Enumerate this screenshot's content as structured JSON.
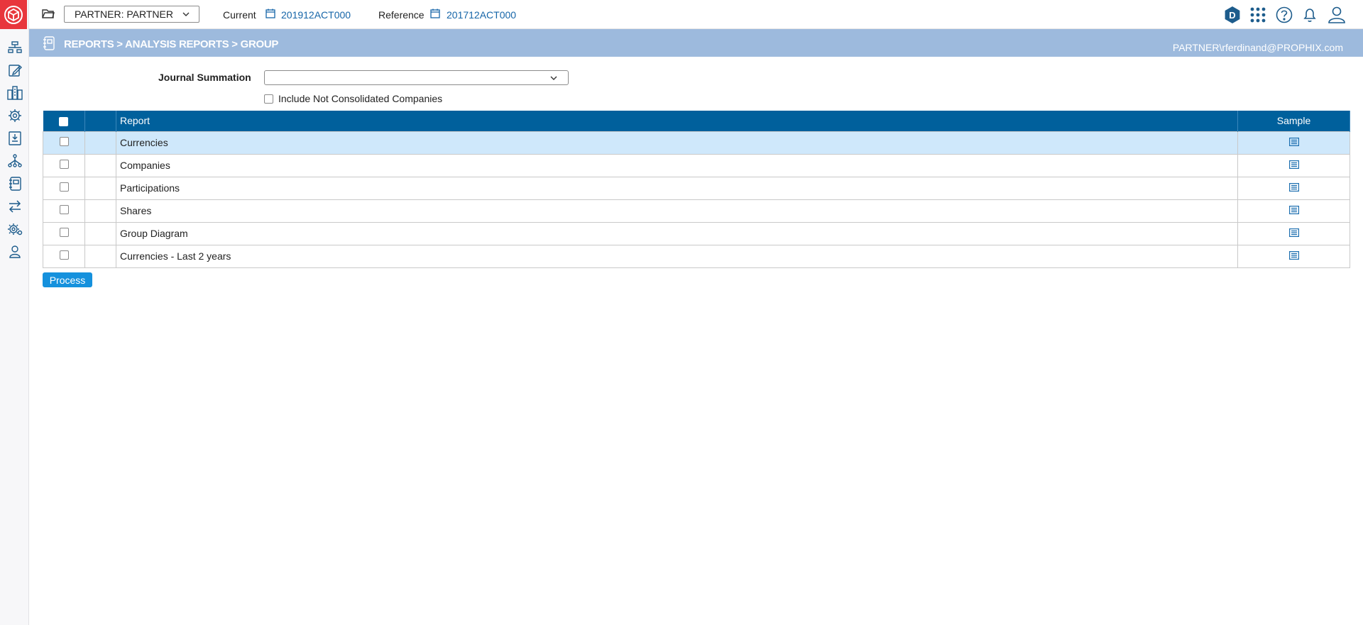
{
  "topbar": {
    "entity_select": "PARTNER: PARTNER",
    "current_label": "Current",
    "current_value": "201912ACT000",
    "reference_label": "Reference",
    "reference_value": "201712ACT000",
    "badge_letter": "D"
  },
  "header": {
    "breadcrumb": "REPORTS > ANALYSIS REPORTS > GROUP",
    "user": "PARTNER\\rferdinand@PROPHIX.com"
  },
  "form": {
    "journal_summation_label": "Journal Summation",
    "journal_summation_value": "",
    "include_not_consolidated_label": "Include Not Consolidated Companies"
  },
  "table": {
    "columns": {
      "report": "Report",
      "sample": "Sample"
    },
    "rows": [
      {
        "report": "Currencies",
        "selected": true
      },
      {
        "report": "Companies",
        "selected": false
      },
      {
        "report": "Participations",
        "selected": false
      },
      {
        "report": "Shares",
        "selected": false
      },
      {
        "report": "Group Diagram",
        "selected": false
      },
      {
        "report": "Currencies - Last 2 years",
        "selected": false
      }
    ]
  },
  "actions": {
    "process_label": "Process"
  },
  "colors": {
    "brand_red": "#e8363c",
    "header_band": "#9dbadd",
    "table_header": "#00609c",
    "link_blue": "#1565a8",
    "button_blue": "#1591dd",
    "row_selected": "#cfe8fb"
  },
  "sidebar_icons": [
    "process-flow-icon",
    "data-entry-icon",
    "company-structure-icon",
    "consolidation-settings-icon",
    "journal-import-icon",
    "hierarchy-icon",
    "reports-icon",
    "transfer-icon",
    "administration-icon",
    "users-icon"
  ]
}
